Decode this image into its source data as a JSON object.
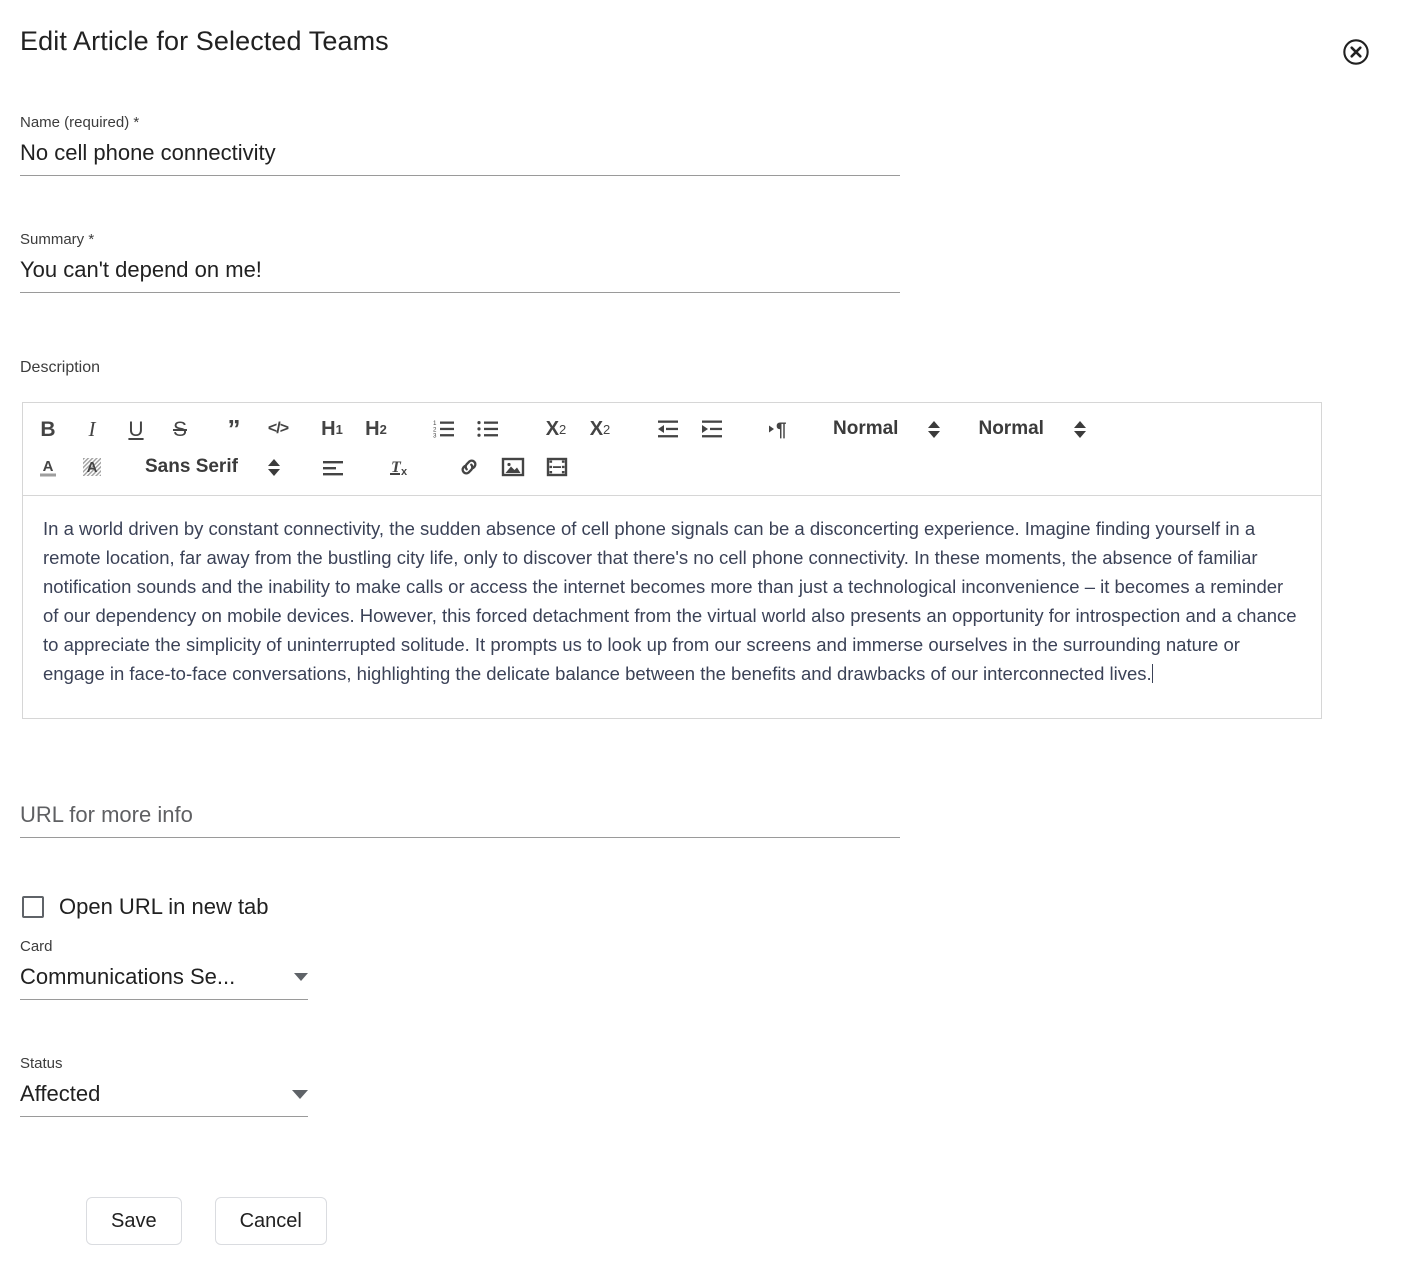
{
  "dialog": {
    "title": "Edit Article for Selected Teams",
    "close_icon": "close-circle-icon"
  },
  "fields": {
    "name": {
      "label": "Name (required) *",
      "value": "No cell phone connectivity"
    },
    "summary": {
      "label": "Summary *",
      "value": "You can't depend on me!"
    },
    "description": {
      "label": "Description",
      "text": "In a world driven by constant connectivity, the sudden absence of cell phone signals can be a disconcerting experience. Imagine finding yourself in a remote location, far away from the bustling city life, only to discover that there's no cell phone connectivity. In these moments, the absence of familiar notification sounds and the inability to make calls or access the internet becomes more than just a technological inconvenience – it becomes a reminder of our dependency on mobile devices. However, this forced detachment from the virtual world also presents an opportunity for introspection and a chance to appreciate the simplicity of uninterrupted solitude. It prompts us to look up from our screens and immerse ourselves in the surrounding nature or engage in face-to-face conversations, highlighting the delicate balance between the benefits and drawbacks of our interconnected lives."
    },
    "url": {
      "placeholder": "URL for more info",
      "value": ""
    },
    "open_in_new_tab": {
      "label": "Open URL in new tab",
      "checked": false
    },
    "card": {
      "label": "Card",
      "value": "Communications Se..."
    },
    "status": {
      "label": "Status",
      "value": "Affected"
    }
  },
  "toolbar": {
    "row1": [
      {
        "name": "bold",
        "glyph": "B"
      },
      {
        "name": "italic",
        "glyph": "I"
      },
      {
        "name": "underline",
        "glyph": "U"
      },
      {
        "name": "strikethrough",
        "glyph": "S"
      },
      {
        "name": "blockquote",
        "glyph": "”"
      },
      {
        "name": "code-block",
        "glyph": "</>"
      },
      {
        "name": "heading-1",
        "glyph": "H1"
      },
      {
        "name": "heading-2",
        "glyph": "H2"
      },
      {
        "name": "ordered-list",
        "glyph": ""
      },
      {
        "name": "bullet-list",
        "glyph": ""
      },
      {
        "name": "subscript",
        "glyph": "X2"
      },
      {
        "name": "superscript",
        "glyph": "X2"
      },
      {
        "name": "outdent",
        "glyph": ""
      },
      {
        "name": "indent",
        "glyph": ""
      },
      {
        "name": "text-direction",
        "glyph": "¶"
      }
    ],
    "row2": [
      {
        "name": "font-color",
        "glyph": "A"
      },
      {
        "name": "highlight-color",
        "glyph": "A"
      },
      {
        "name": "align",
        "glyph": ""
      },
      {
        "name": "clear-format",
        "glyph": "Tx"
      },
      {
        "name": "link",
        "glyph": ""
      },
      {
        "name": "image",
        "glyph": ""
      },
      {
        "name": "video",
        "glyph": ""
      }
    ],
    "size_select": "Normal",
    "style_select": "Normal",
    "font_select": "Sans Serif"
  },
  "actions": {
    "save": "Save",
    "cancel": "Cancel"
  },
  "colors": {
    "text": "#212121",
    "body_text": "#3b4257",
    "border": "#d6d6d6",
    "underline": "#9a9a9a",
    "icon": "#444444"
  }
}
